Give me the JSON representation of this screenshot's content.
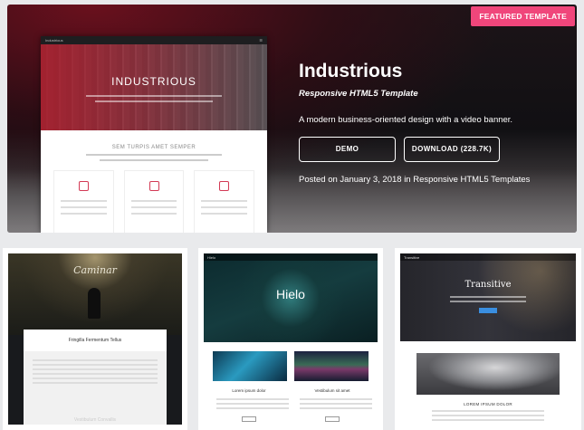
{
  "featured": {
    "badge": "FEATURED TEMPLATE",
    "title": "Industrious",
    "subtitle": "Responsive HTML5 Template",
    "description": "A modern business-oriented design with a video banner.",
    "demo_label": "DEMO",
    "download_label": "DOWNLOAD (228.7K)",
    "posted": "Posted on January 3, 2018 in Responsive HTML5 Templates",
    "preview": {
      "brand": "Industrious",
      "banner_title": "INDUSTRIOUS",
      "section_title": "SEM TURPIS AMET SEMPER"
    },
    "colors": {
      "badge": "#f0467b",
      "accent": "#d33a55"
    }
  },
  "thumbnails": [
    {
      "name": "Caminar",
      "panel_title": "Fringilla Fermentum Tellus",
      "footer_text": "Vestibulum Convallis"
    },
    {
      "name": "Hielo",
      "brand": "Hielo",
      "tile1": "Lorem ipsum dolor",
      "tile2": "Vestibulum sit amet"
    },
    {
      "name": "Transitive",
      "brand": "Transitive",
      "section_title": "LOREM IPSUM DOLOR"
    }
  ]
}
